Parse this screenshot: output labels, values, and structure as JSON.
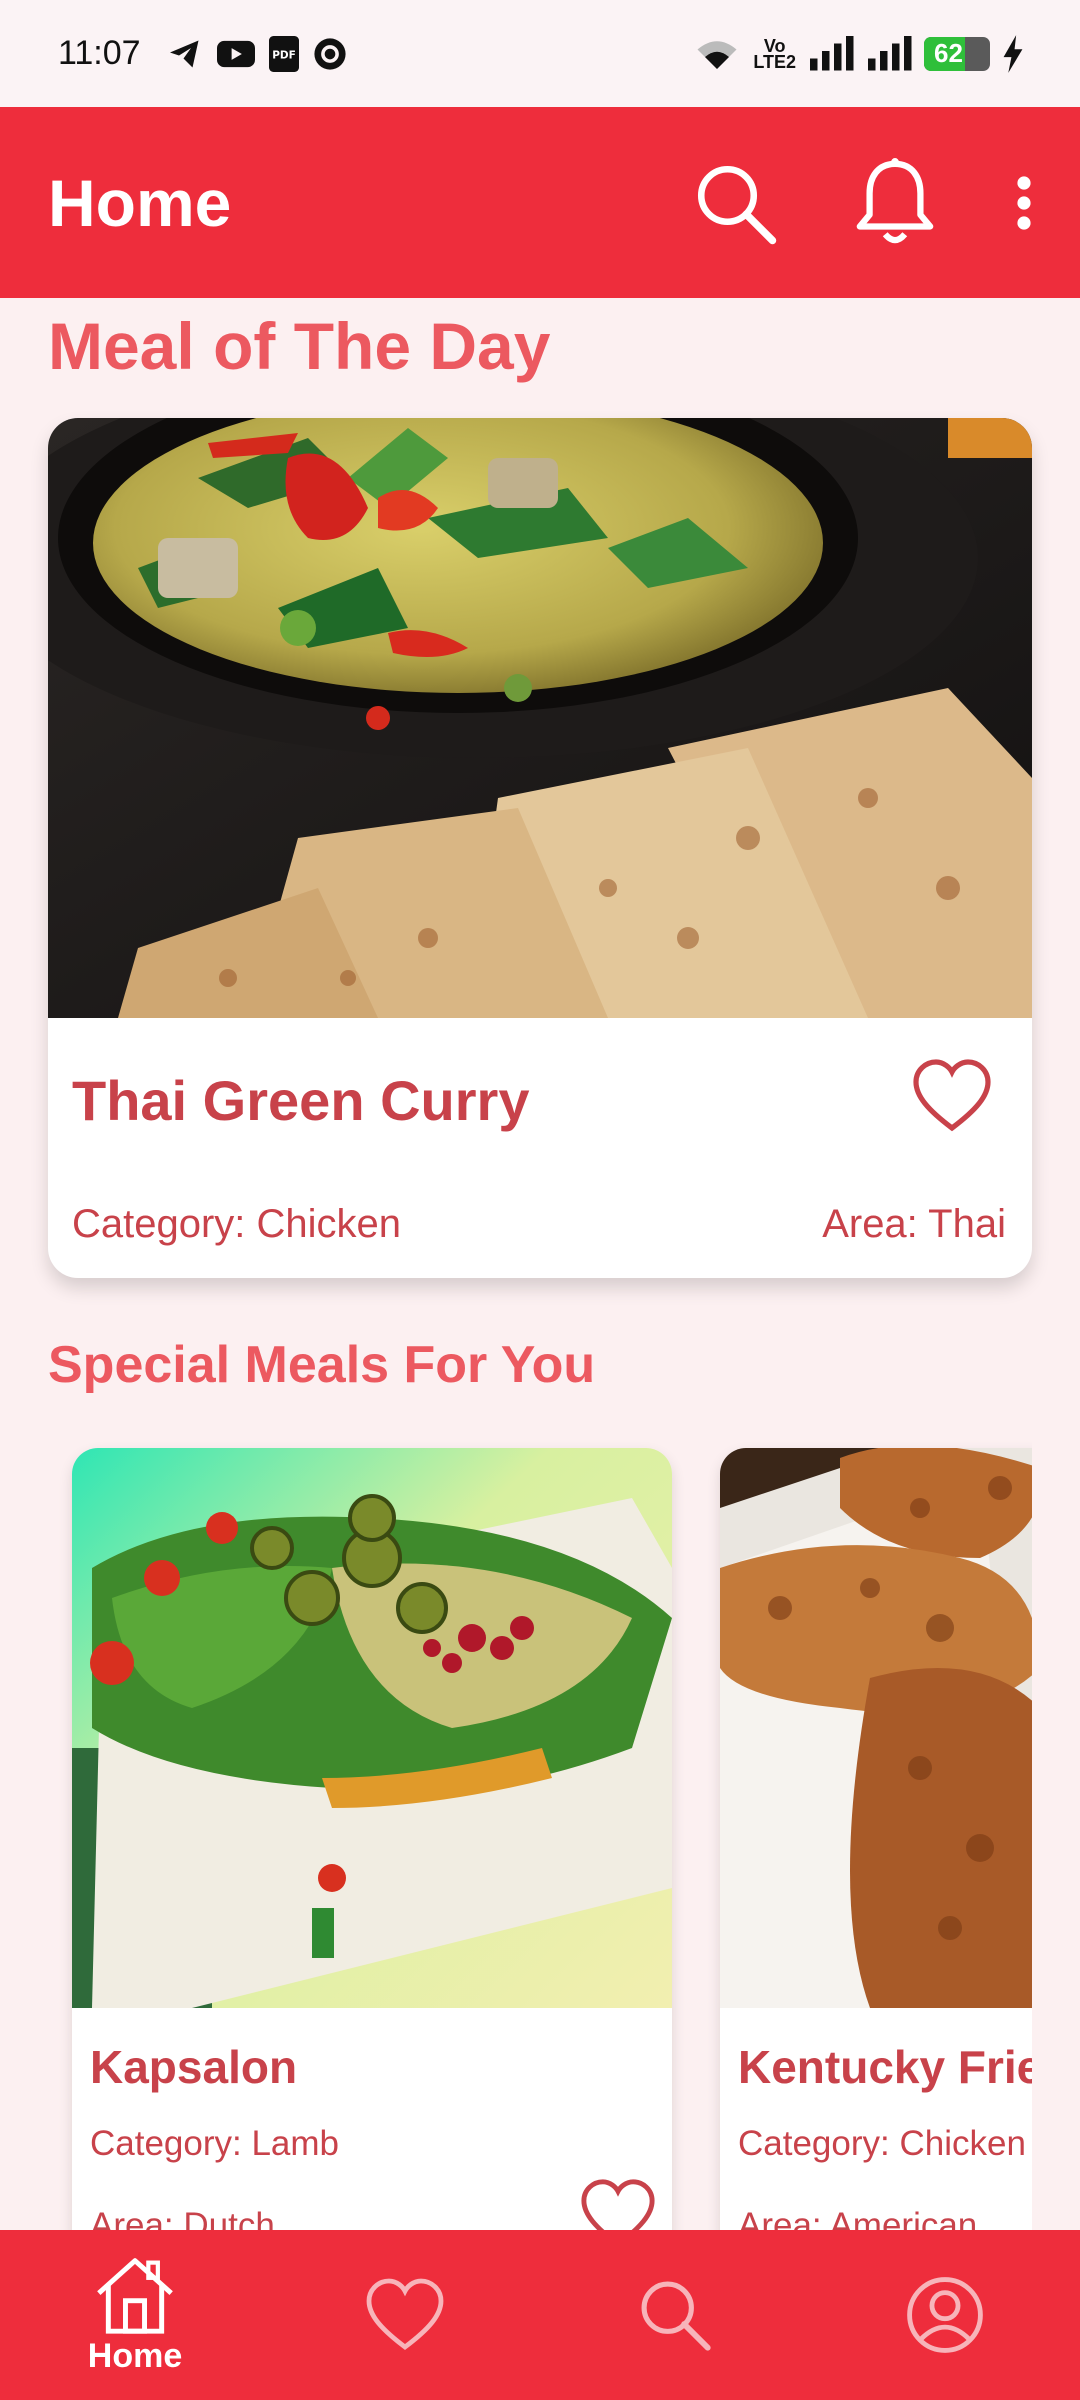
{
  "status_bar": {
    "time": "11:07",
    "network_label_top": "Vo",
    "network_label_bottom": "LTE2",
    "battery_level": "62",
    "battery_percent": 62,
    "left_icons": [
      "telegram-icon",
      "youtube-icon",
      "pdf-icon",
      "browser-icon"
    ],
    "right_icons": [
      "wifi-icon",
      "signal-icon",
      "signal-icon",
      "battery-icon",
      "charging-icon"
    ]
  },
  "app_bar": {
    "title": "Home",
    "actions": [
      "search-icon",
      "bell-icon",
      "more-vert-icon"
    ],
    "color": "#ee2d3c"
  },
  "meal_of_the_day": {
    "section_title": "Meal of The Day",
    "name": "Thai Green Curry",
    "category": "Category: Chicken",
    "area": "Area: Thai",
    "favorite": false
  },
  "special_meals": {
    "section_title": "Special Meals For You",
    "items": [
      {
        "name": "Kapsalon",
        "category": "Category: Lamb",
        "area": "Area: Dutch",
        "favorite": false
      },
      {
        "name": "Kentucky Fried Chicken",
        "category": "Category: Chicken",
        "area": "Area: American",
        "favorite": false
      }
    ]
  },
  "bottom_nav": {
    "items": [
      {
        "icon": "home-icon",
        "label": "Home",
        "active": true
      },
      {
        "icon": "heart-icon",
        "label": "",
        "active": false
      },
      {
        "icon": "search-icon",
        "label": "",
        "active": false
      },
      {
        "icon": "profile-icon",
        "label": "",
        "active": false
      }
    ]
  },
  "colors": {
    "accent": "#ee2d3c",
    "title_text": "#ec5960",
    "card_text": "#c8424a",
    "background": "#fcf0f1"
  }
}
